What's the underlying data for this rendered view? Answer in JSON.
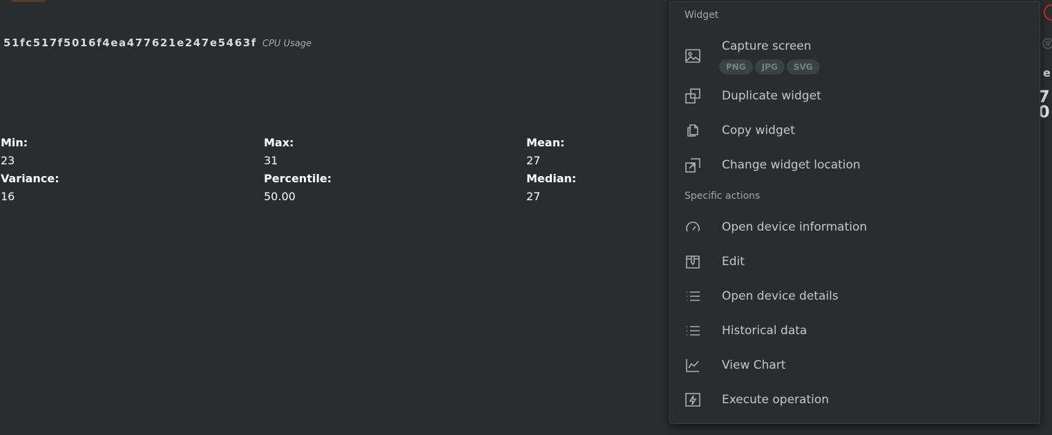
{
  "widget": {
    "device_id": "51fc517f5016f4ea477621e247e5463f",
    "subtitle": "CPU Usage",
    "stats": [
      {
        "label": "Min:",
        "value": "23"
      },
      {
        "label": "Max:",
        "value": "31"
      },
      {
        "label": "Mean:",
        "value": "27"
      },
      {
        "label": "Variance:",
        "value": "16"
      },
      {
        "label": "Percentile:",
        "value": "50.00"
      },
      {
        "label": "Median:",
        "value": "27"
      }
    ]
  },
  "edge": {
    "frag1": "e",
    "frag2": "7",
    "frag3": "0"
  },
  "menu": {
    "section_widget": "Widget",
    "section_specific": "Specific actions",
    "capture": {
      "label": "Capture screen",
      "icon": "image-icon",
      "formats": [
        "PNG",
        "JPG",
        "SVG"
      ]
    },
    "items_widget": [
      {
        "label": "Duplicate widget",
        "icon": "duplicate-icon"
      },
      {
        "label": "Copy widget",
        "icon": "copy-icon"
      },
      {
        "label": "Change widget location",
        "icon": "move-icon"
      }
    ],
    "items_specific": [
      {
        "label": "Open device information",
        "icon": "speedometer-icon"
      },
      {
        "label": "Edit",
        "icon": "edit-icon"
      },
      {
        "label": "Open device details",
        "icon": "list-icon"
      },
      {
        "label": "Historical data",
        "icon": "list-icon"
      },
      {
        "label": "View Chart",
        "icon": "chart-icon"
      },
      {
        "label": "Execute operation",
        "icon": "bolt-icon"
      }
    ]
  }
}
